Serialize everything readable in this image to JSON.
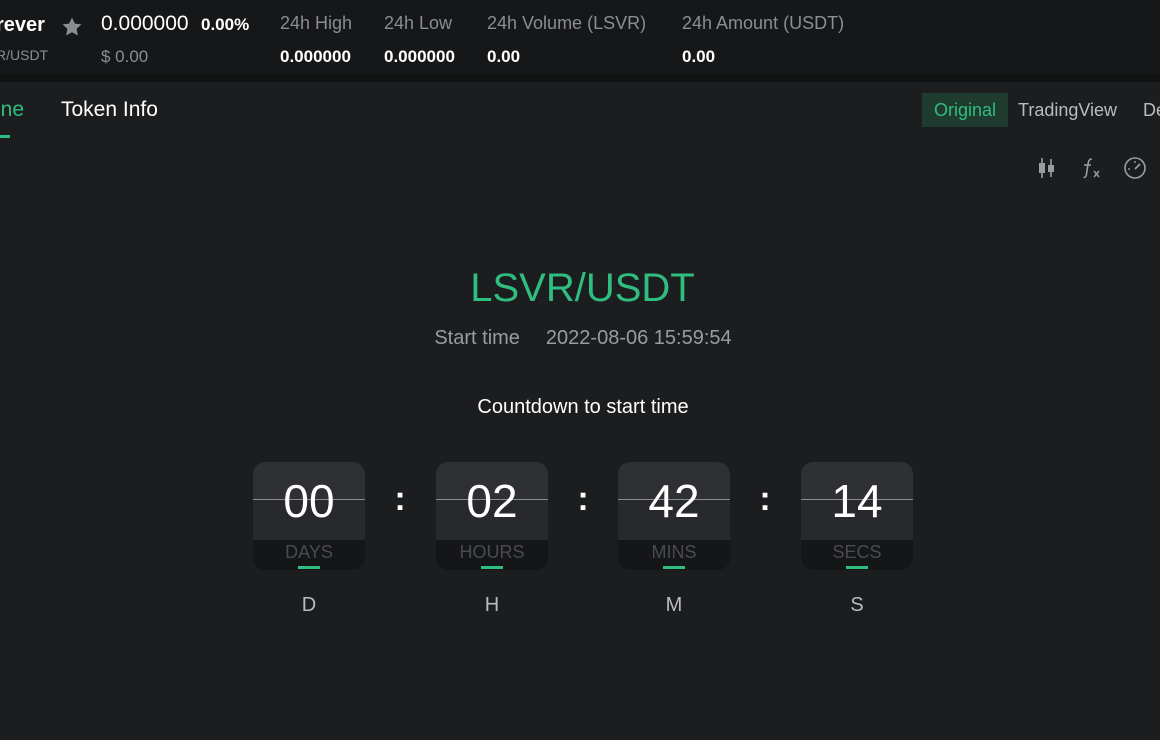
{
  "header": {
    "pair_name": "rever",
    "pair_sub": "R/USDT",
    "star_icon": "star-icon",
    "price": "0.000000",
    "change": "0.00%",
    "usd_price": "$ 0.00",
    "stats": [
      {
        "label": "24h High",
        "value": "0.000000"
      },
      {
        "label": "24h Low",
        "value": "0.000000"
      },
      {
        "label": "24h Volume (LSVR)",
        "value": "0.00"
      },
      {
        "label": "24h Amount (USDT)",
        "value": "0.00"
      }
    ]
  },
  "tabs": {
    "active": "ine",
    "token_info": "Token Info"
  },
  "views": {
    "original": "Original",
    "tradingview": "TradingView",
    "depth": "De"
  },
  "tools": [
    "candlestick-icon",
    "function-icon",
    "speedometer-icon"
  ],
  "countdown": {
    "pair": "LSVR/USDT",
    "start_label": "Start time",
    "start_value": "2022-08-06 15:59:54",
    "caption": "Countdown to start time",
    "separator": ":",
    "units": [
      {
        "value": "00",
        "unit": "DAYS",
        "letter": "D"
      },
      {
        "value": "02",
        "unit": "HOURS",
        "letter": "H"
      },
      {
        "value": "42",
        "unit": "MINS",
        "letter": "M"
      },
      {
        "value": "14",
        "unit": "SECS",
        "letter": "S"
      }
    ]
  },
  "colors": {
    "accent": "#2fbe80",
    "background": "#1c1d1f",
    "header_background": "#161718"
  }
}
